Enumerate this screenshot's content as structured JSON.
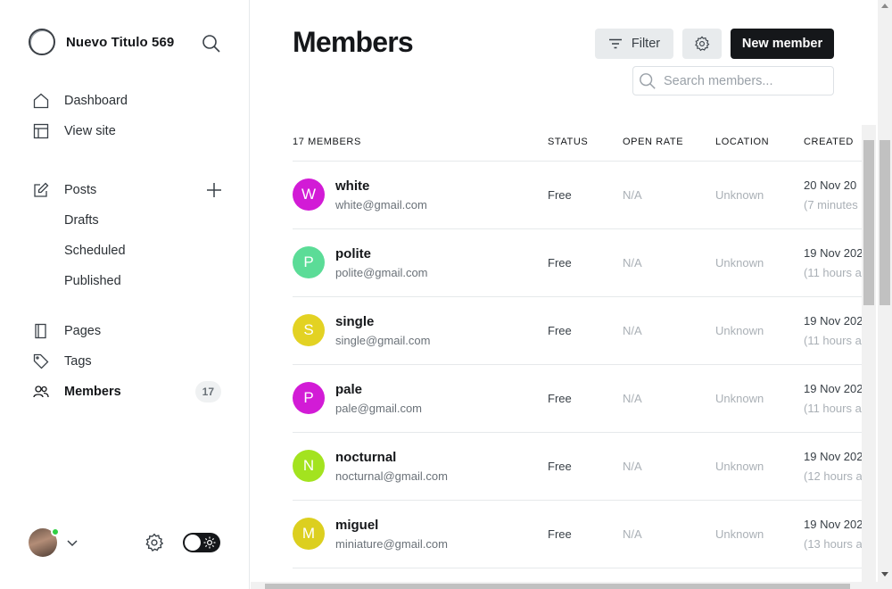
{
  "brand": {
    "title": "Nuevo Titulo 569"
  },
  "nav": {
    "dashboard": "Dashboard",
    "view_site": "View site",
    "posts": "Posts",
    "drafts": "Drafts",
    "scheduled": "Scheduled",
    "published": "Published",
    "pages": "Pages",
    "tags": "Tags",
    "members": "Members",
    "members_count": "17"
  },
  "header": {
    "title": "Members",
    "filter_label": "Filter",
    "new_member_label": "New member",
    "search_placeholder": "Search members..."
  },
  "table": {
    "columns": {
      "count": "17 MEMBERS",
      "status": "STATUS",
      "open_rate": "OPEN RATE",
      "location": "LOCATION",
      "created": "CREATED"
    },
    "rows": [
      {
        "initial": "W",
        "name": "white",
        "email": "white@gmail.com",
        "status": "Free",
        "open_rate": "N/A",
        "location": "Unknown",
        "created": "20 Nov 20",
        "ago": "(7 minutes",
        "color": "#d21bd6"
      },
      {
        "initial": "P",
        "name": "polite",
        "email": "polite@gmail.com",
        "status": "Free",
        "open_rate": "N/A",
        "location": "Unknown",
        "created": "19 Nov 202",
        "ago": "(11 hours a",
        "color": "#5bdc97"
      },
      {
        "initial": "S",
        "name": "single",
        "email": "single@gmail.com",
        "status": "Free",
        "open_rate": "N/A",
        "location": "Unknown",
        "created": "19 Nov 202",
        "ago": "(11 hours a",
        "color": "#e3d223"
      },
      {
        "initial": "P",
        "name": "pale",
        "email": "pale@gmail.com",
        "status": "Free",
        "open_rate": "N/A",
        "location": "Unknown",
        "created": "19 Nov 202",
        "ago": "(11 hours a",
        "color": "#d21bd6"
      },
      {
        "initial": "N",
        "name": "nocturnal",
        "email": "nocturnal@gmail.com",
        "status": "Free",
        "open_rate": "N/A",
        "location": "Unknown",
        "created": "19 Nov 202",
        "ago": "(12 hours a",
        "color": "#a3e31f"
      },
      {
        "initial": "M",
        "name": "miguel",
        "email": "miniature@gmail.com",
        "status": "Free",
        "open_rate": "N/A",
        "location": "Unknown",
        "created": "19 Nov 202",
        "ago": "(13 hours a",
        "color": "#dccf1f"
      }
    ]
  },
  "icons": {
    "brand": "circle-logo-icon",
    "search": "search-icon",
    "dashboard": "home-icon",
    "view_site": "layout-icon",
    "posts": "edit-icon",
    "add": "plus-icon",
    "pages": "document-icon",
    "tags": "tag-icon",
    "members": "users-icon",
    "settings": "gear-icon",
    "filter": "filter-icon",
    "theme": "sun-icon",
    "menu": "chevron-down-icon"
  },
  "colors": {
    "accent_dark": "#15171a",
    "online": "#30cf43"
  }
}
